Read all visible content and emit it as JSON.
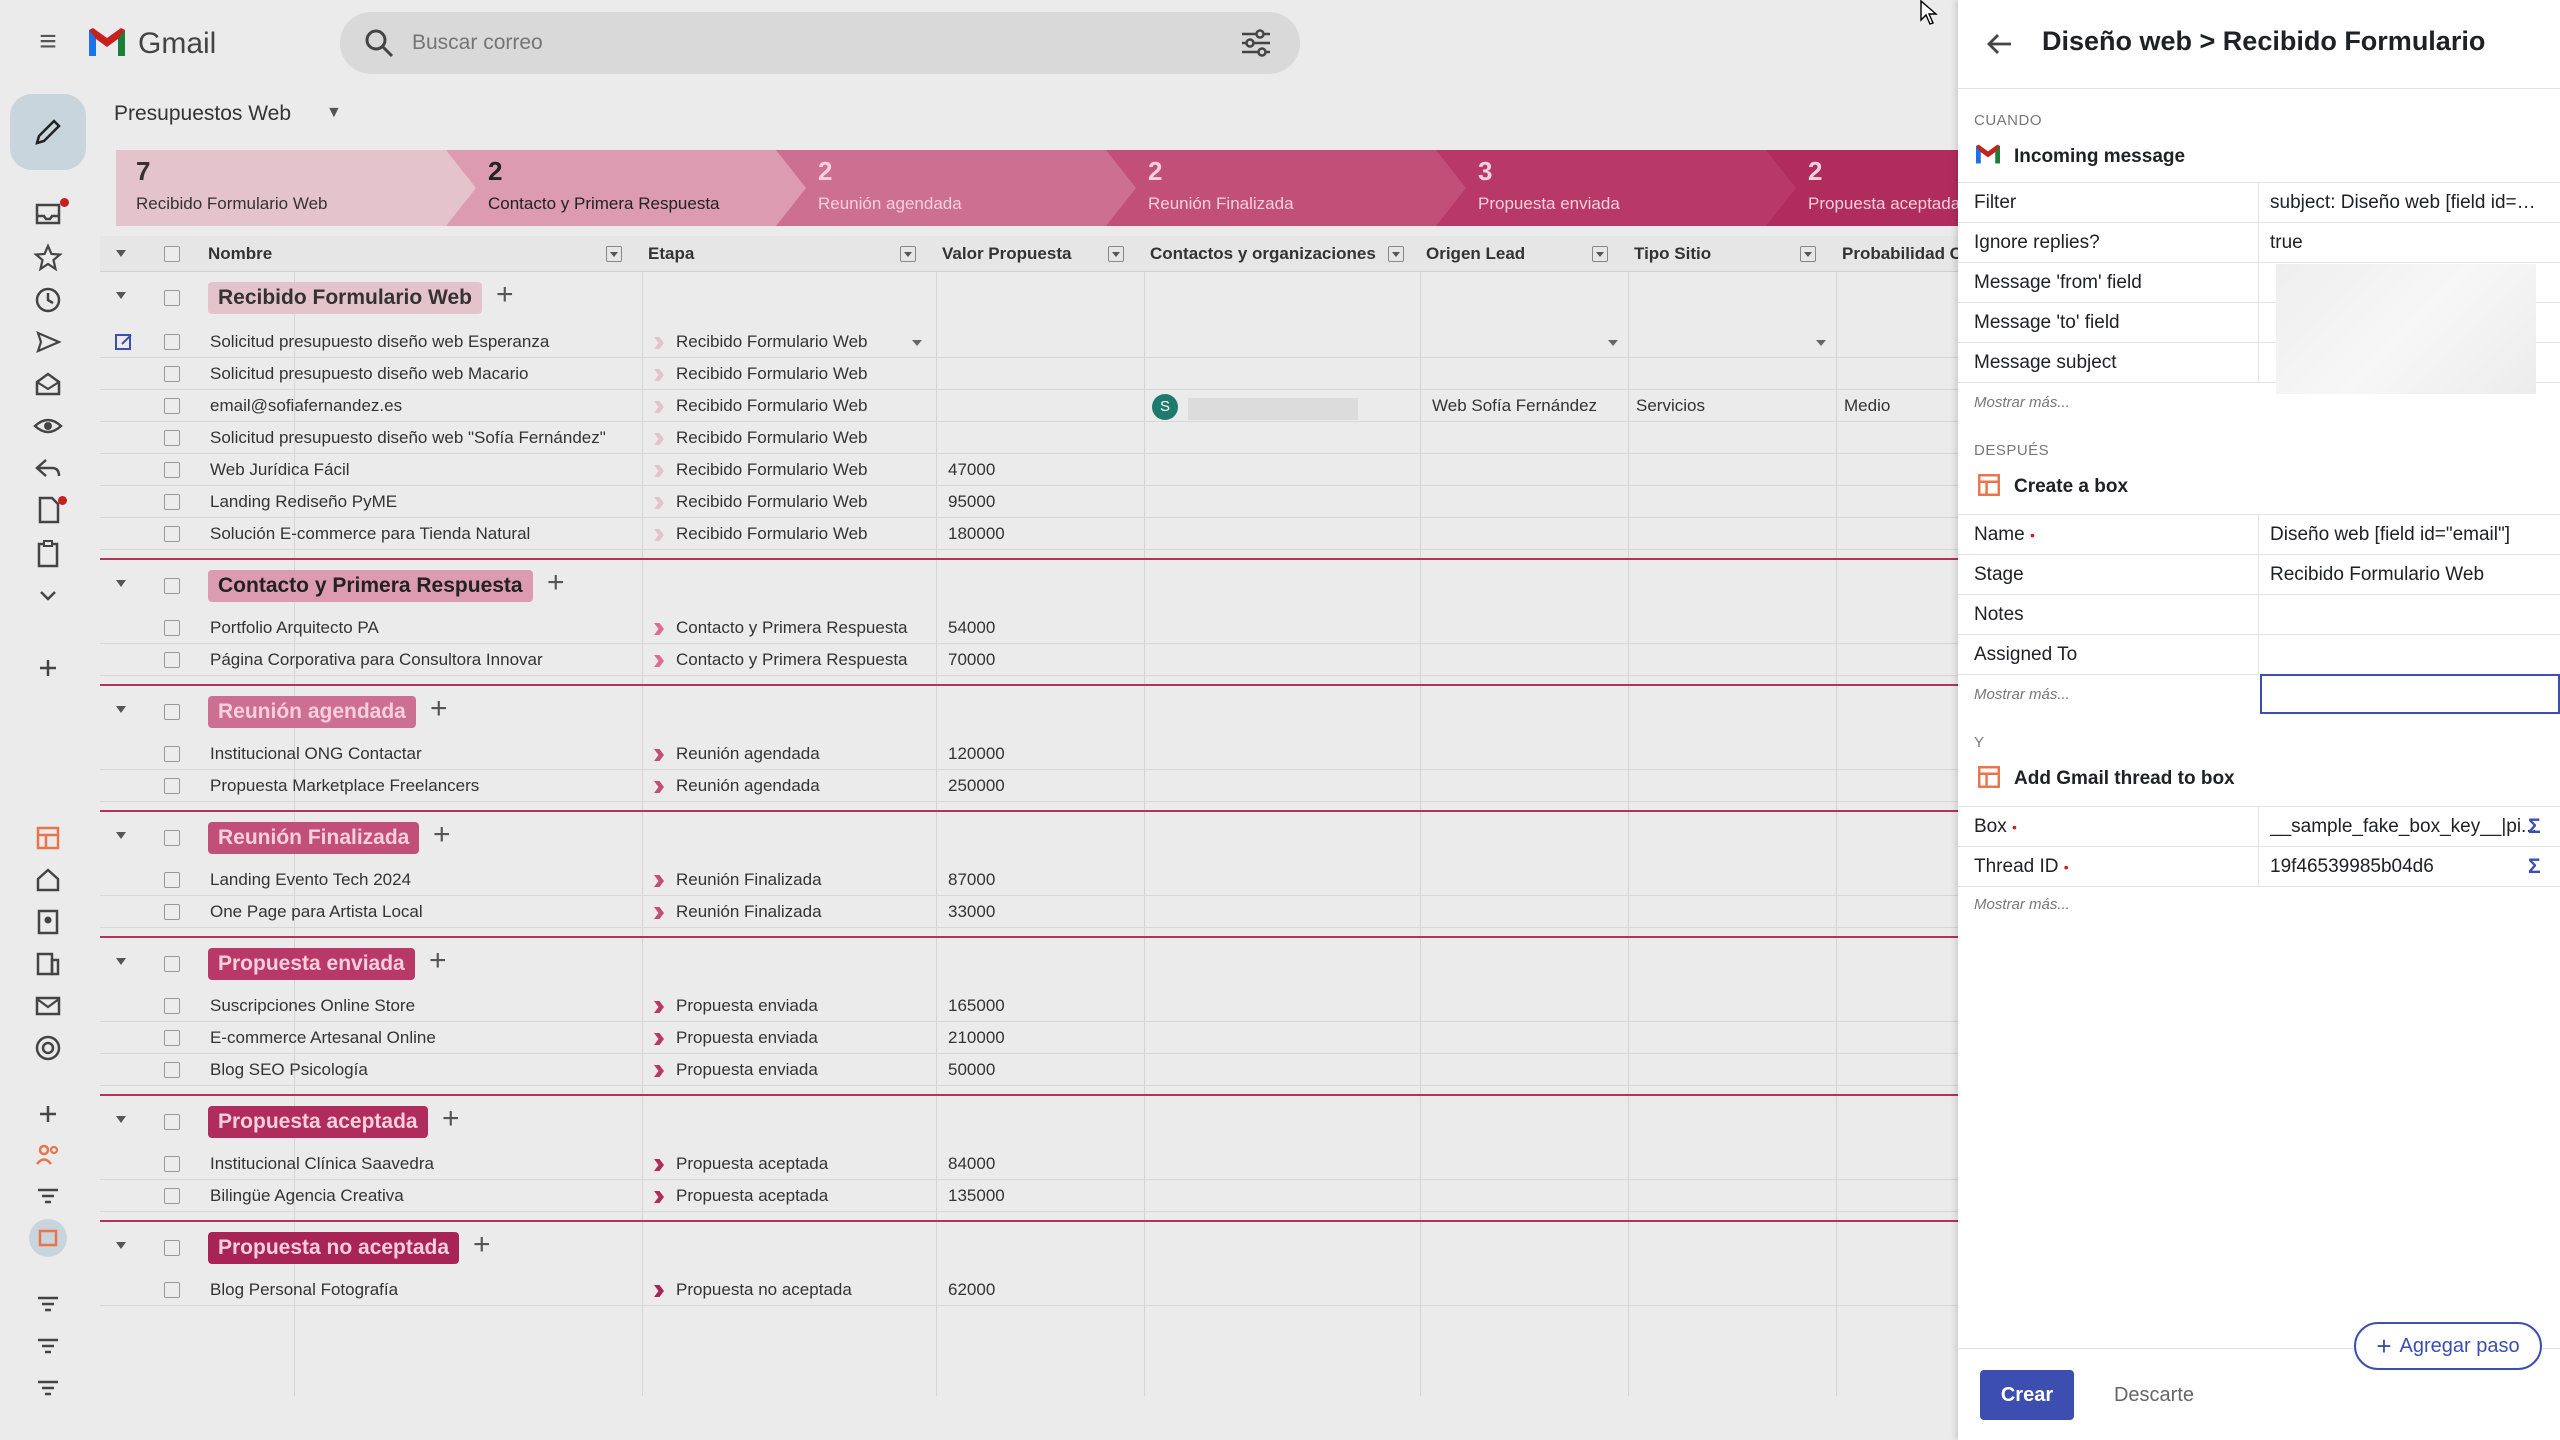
{
  "gmail": {
    "logo_text": "Gmail",
    "search_placeholder": "Buscar correo"
  },
  "view": {
    "title": "Presupuestos Web"
  },
  "colors": {
    "stage1": "#e4c3cd",
    "stage2": "#dc9bb1",
    "stage3": "#cd6f91",
    "stage4": "#c24f78",
    "stage5": "#b83968",
    "stage6": "#b02c5d",
    "accent": "#3c4fb0",
    "group_border": "#b2345a"
  },
  "stages": [
    {
      "count": "7",
      "label": "Recibido Formulario Web"
    },
    {
      "count": "2",
      "label": "Contacto y Primera Respuesta"
    },
    {
      "count": "2",
      "label": "Reunión agendada"
    },
    {
      "count": "2",
      "label": "Reunión Finalizada"
    },
    {
      "count": "3",
      "label": "Propuesta enviada"
    },
    {
      "count": "2",
      "label": "Propuesta aceptada"
    }
  ],
  "columns": [
    "Nombre",
    "Etapa",
    "Valor Propuesta",
    "Contactos y organizaciones",
    "Origen Lead",
    "Tipo Sitio",
    "Probabilidad Cierre"
  ],
  "groups": [
    {
      "name": "Recibido Formulario Web",
      "rows": [
        {
          "nombre": "Solicitud presupuesto diseño web Esperanza",
          "etapa": "Recibido Formulario Web",
          "valor": ""
        },
        {
          "nombre": "Solicitud presupuesto diseño web Macario",
          "etapa": "Recibido Formulario Web",
          "valor": ""
        },
        {
          "nombre": "email@sofiafernandez.es",
          "etapa": "Recibido Formulario Web",
          "valor": "",
          "contacto": "S",
          "origen": "Web Sofía Fernández",
          "tipo": "Servicios",
          "prob": "Medio"
        },
        {
          "nombre": "Solicitud presupuesto diseño web \"Sofía Fernández\"",
          "etapa": "Recibido Formulario Web",
          "valor": ""
        },
        {
          "nombre": "Web Jurídica Fácil",
          "etapa": "Recibido Formulario Web",
          "valor": "47000"
        },
        {
          "nombre": "Landing Rediseño PyME",
          "etapa": "Recibido Formulario Web",
          "valor": "95000"
        },
        {
          "nombre": "Solución E-commerce para Tienda Natural",
          "etapa": "Recibido Formulario Web",
          "valor": "180000"
        }
      ]
    },
    {
      "name": "Contacto y Primera Respuesta",
      "rows": [
        {
          "nombre": "Portfolio Arquitecto PA",
          "etapa": "Contacto y Primera Respuesta",
          "valor": "54000"
        },
        {
          "nombre": "Página Corporativa para Consultora Innovar",
          "etapa": "Contacto y Primera Respuesta",
          "valor": "70000"
        }
      ]
    },
    {
      "name": "Reunión agendada",
      "rows": [
        {
          "nombre": "Institucional ONG Contactar",
          "etapa": "Reunión agendada",
          "valor": "120000"
        },
        {
          "nombre": "Propuesta Marketplace Freelancers",
          "etapa": "Reunión agendada",
          "valor": "250000"
        }
      ]
    },
    {
      "name": "Reunión Finalizada",
      "rows": [
        {
          "nombre": "Landing Evento Tech 2024",
          "etapa": "Reunión Finalizada",
          "valor": "87000"
        },
        {
          "nombre": "One Page para Artista Local",
          "etapa": "Reunión Finalizada",
          "valor": "33000"
        }
      ]
    },
    {
      "name": "Propuesta enviada",
      "rows": [
        {
          "nombre": "Suscripciones Online Store",
          "etapa": "Propuesta enviada",
          "valor": "165000"
        },
        {
          "nombre": "E-commerce Artesanal Online",
          "etapa": "Propuesta enviada",
          "valor": "210000"
        },
        {
          "nombre": "Blog SEO Psicología",
          "etapa": "Propuesta enviada",
          "valor": "50000"
        }
      ]
    },
    {
      "name": "Propuesta aceptada",
      "rows": [
        {
          "nombre": "Institucional Clínica Saavedra",
          "etapa": "Propuesta aceptada",
          "valor": "84000"
        },
        {
          "nombre": "Bilingüe Agencia Creativa",
          "etapa": "Propuesta aceptada",
          "valor": "135000"
        }
      ]
    },
    {
      "name": "Propuesta no aceptada",
      "rows": [
        {
          "nombre": "Blog Personal Fotografía",
          "etapa": "Propuesta no aceptada",
          "valor": "62000"
        }
      ]
    }
  ],
  "panel": {
    "title": "Diseño web > Recibido Formulario",
    "when": {
      "label": "CUANDO",
      "head": "Incoming message",
      "fields": [
        {
          "key": "Filter",
          "value": "subject: Diseño web [field id=\"e..."
        },
        {
          "key": "Ignore replies?",
          "value": "true"
        },
        {
          "key": "Message 'from' field",
          "value": ""
        },
        {
          "key": "Message 'to' field",
          "value": ""
        },
        {
          "key": "Message subject",
          "value": ""
        }
      ],
      "more": "Mostrar más..."
    },
    "then": {
      "label": "DESPUÉS",
      "head": "Create a box",
      "fields": [
        {
          "key": "Name",
          "value": "Diseño web [field id=\"email\"]",
          "required": "•"
        },
        {
          "key": "Stage",
          "value": "Recibido Formulario Web"
        },
        {
          "key": "Notes",
          "value": ""
        },
        {
          "key": "Assigned To",
          "value": ""
        }
      ],
      "more": "Mostrar más..."
    },
    "and": {
      "label": "Y",
      "head": "Add Gmail thread to box",
      "fields": [
        {
          "key": "Box",
          "value": "__sample_fake_box_key__|pi...",
          "required": "•",
          "sigma": "Σ"
        },
        {
          "key": "Thread ID",
          "value": "19f46539985b04d6",
          "required": "•",
          "sigma": "Σ"
        }
      ],
      "more": "Mostrar más..."
    },
    "add_step": "Agregar paso",
    "create": "Crear",
    "discard": "Descarte"
  }
}
